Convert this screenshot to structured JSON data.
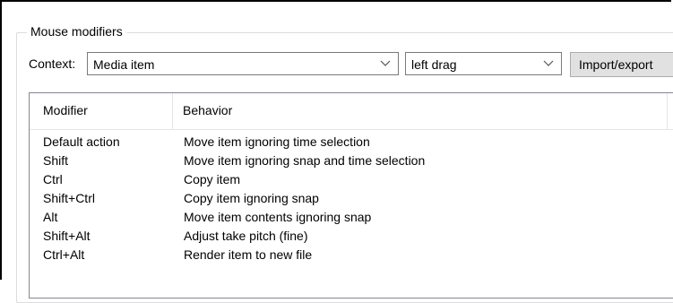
{
  "group": {
    "title": "Mouse modifiers"
  },
  "context": {
    "label": "Context:",
    "selected": "Media item",
    "action_selected": "left drag",
    "import_export_label": "Import/export"
  },
  "table": {
    "columns": [
      "Modifier",
      "Behavior"
    ],
    "rows": [
      {
        "modifier": "Default action",
        "behavior": "Move item ignoring time selection"
      },
      {
        "modifier": "Shift",
        "behavior": "Move item ignoring snap and time selection"
      },
      {
        "modifier": "Ctrl",
        "behavior": "Copy item"
      },
      {
        "modifier": "Shift+Ctrl",
        "behavior": "Copy item ignoring snap"
      },
      {
        "modifier": "Alt",
        "behavior": "Move item contents ignoring snap"
      },
      {
        "modifier": "Shift+Alt",
        "behavior": "Adjust take pitch (fine)"
      },
      {
        "modifier": "Ctrl+Alt",
        "behavior": "Render item to new file"
      }
    ]
  },
  "icons": {
    "dropdown": "chevron-down-icon"
  },
  "colors": {
    "border": "#7a7a7a",
    "button_bg": "#e1e1e1",
    "list_border": "#828790"
  }
}
